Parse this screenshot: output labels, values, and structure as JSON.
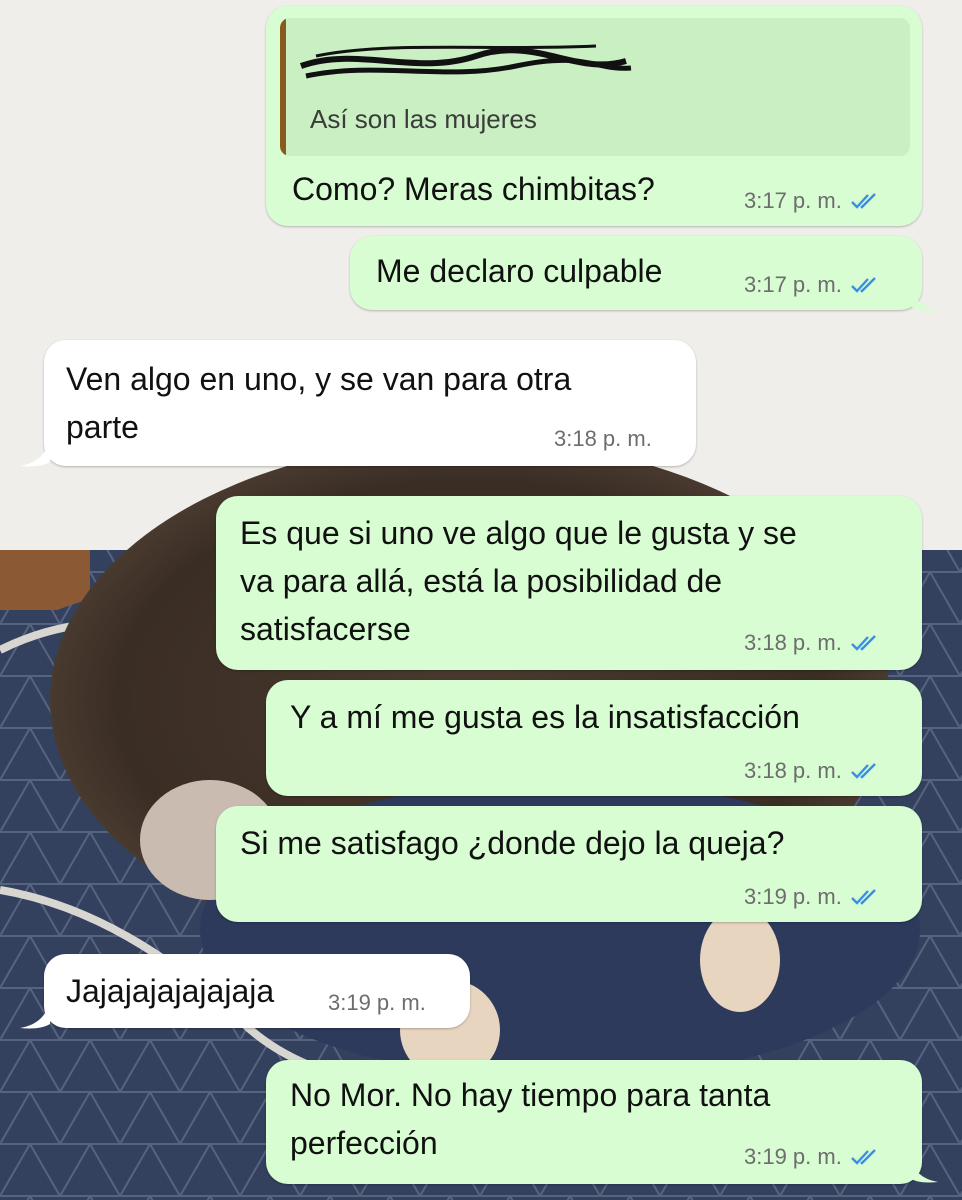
{
  "colors": {
    "outgoing_bubble": "#d8fdd2",
    "incoming_bubble": "#ffffff",
    "read_ticks": "#3a8ee6",
    "quote_bar": "#8a5a1d"
  },
  "quoted": {
    "author": "",
    "text": "Así son las mujeres"
  },
  "messages": [
    {
      "id": "m1",
      "direction": "outgoing",
      "lines": [
        "Como? Meras chimbitas?"
      ],
      "time": "3:17 p. m.",
      "status_icon": "double-check-icon"
    },
    {
      "id": "m2",
      "direction": "outgoing",
      "lines": [
        "Me declaro culpable"
      ],
      "time": "3:17 p. m.",
      "status_icon": "double-check-icon"
    },
    {
      "id": "m3",
      "direction": "incoming",
      "lines": [
        "Ven algo en uno, y se van para otra",
        "parte"
      ],
      "time": "3:18 p. m."
    },
    {
      "id": "m4",
      "direction": "outgoing",
      "lines": [
        "Es que si uno ve algo que le gusta y se",
        "va para allá, está la posibilidad de",
        "satisfacerse"
      ],
      "time": "3:18 p. m.",
      "status_icon": "double-check-icon"
    },
    {
      "id": "m5",
      "direction": "outgoing",
      "lines": [
        "Y a mí me gusta es la insatisfacción"
      ],
      "time": "3:18 p. m.",
      "status_icon": "double-check-icon"
    },
    {
      "id": "m6",
      "direction": "outgoing",
      "lines": [
        "Si me satisfago ¿donde dejo la queja?"
      ],
      "time": "3:19 p. m.",
      "status_icon": "double-check-icon"
    },
    {
      "id": "m7",
      "direction": "incoming",
      "lines": [
        "Jajajajajajajaja"
      ],
      "time": "3:19 p. m."
    },
    {
      "id": "m8",
      "direction": "outgoing",
      "lines": [
        "No Mor. No hay tiempo para tanta",
        "perfección"
      ],
      "time": "3:19 p. m.",
      "status_icon": "double-check-icon"
    }
  ]
}
